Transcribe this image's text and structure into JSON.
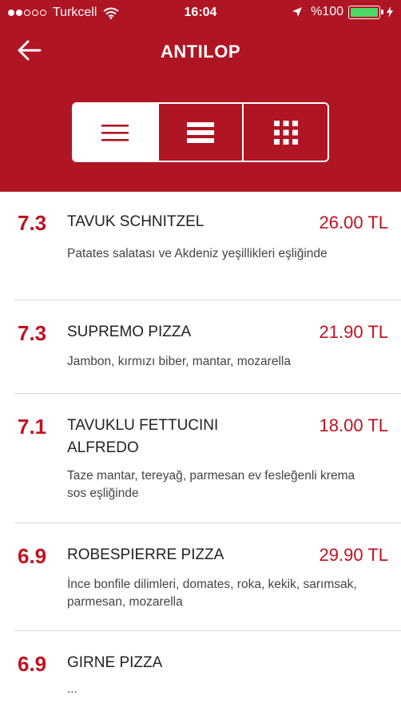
{
  "status_bar": {
    "carrier": "Turkcell",
    "time": "16:04",
    "battery_text": "%100",
    "battery_level": 1.0,
    "signal_dots_filled": 2,
    "signal_dots_total": 5
  },
  "nav": {
    "title": "ANTILOP",
    "back_icon": "arrow-left-icon"
  },
  "view_toggle": {
    "selected_index": 0,
    "options": [
      {
        "icon": "list-view-icon"
      },
      {
        "icon": "compact-list-icon"
      },
      {
        "icon": "grid-view-icon"
      }
    ]
  },
  "colors": {
    "brand_red": "#b01523",
    "accent_red": "#c2111f",
    "battery_green": "#4cd964"
  },
  "menu": [
    {
      "score": "7.3",
      "name": "TAVUK SCHNITZEL",
      "price": "26.00 TL",
      "description": "Patates salatası ve Akdeniz yeşillikleri eşliğinde"
    },
    {
      "score": "7.3",
      "name": "SUPREMO PIZZA",
      "price": "21.90 TL",
      "description": "Jambon, kırmızı biber, mantar, mozarella"
    },
    {
      "score": "7.1",
      "name": "TAVUKLU FETTUCINI ALFREDO",
      "price": "18.00 TL",
      "description": "Taze mantar, tereyağ, parmesan ev fesleğenli krema sos eşliğinde"
    },
    {
      "score": "6.9",
      "name": "ROBESPIERRE PIZZA",
      "price": "29.90 TL",
      "description": "İnce bonfile dilimleri, domates, roka, kekik, sarımsak, parmesan, mozarella"
    },
    {
      "score": "6.9",
      "name": "GIRNE PIZZA",
      "price": "",
      "description": "..."
    }
  ]
}
